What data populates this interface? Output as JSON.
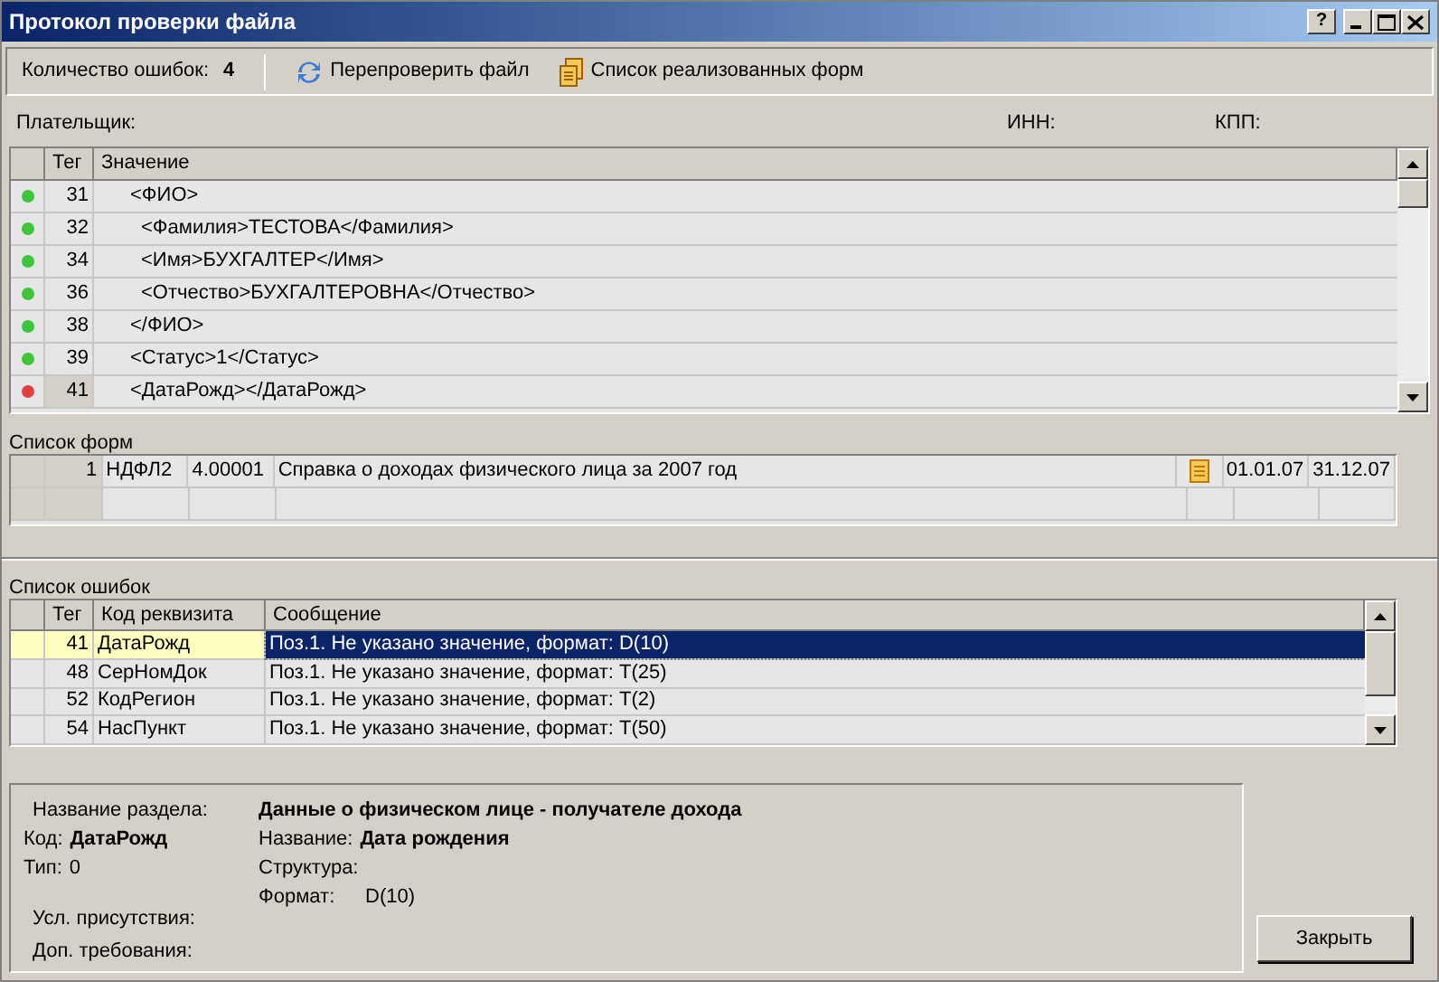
{
  "window": {
    "title": "Протокол проверки файла",
    "buttons": [
      "?"
    ]
  },
  "toolbar": {
    "error_count_label": "Количество ошибок:",
    "error_count": "4",
    "recheck": "Перепроверить файл",
    "forms_list": "Список реализованных форм"
  },
  "payer": {
    "payer_label": "Плательщик:",
    "inn_label": "ИНН:",
    "kpp_label": "КПП:"
  },
  "tree": {
    "columns": [
      "Тег",
      "Значение"
    ],
    "rows": [
      {
        "error": false,
        "tag": "31",
        "value": "<ФИО>",
        "indent": false,
        "selected": false
      },
      {
        "error": false,
        "tag": "32",
        "value": "<Фамилия>ТЕСТОВА</Фамилия>",
        "indent": true,
        "selected": false
      },
      {
        "error": false,
        "tag": "34",
        "value": "<Имя>БУХГАЛТЕР</Имя>",
        "indent": true,
        "selected": false
      },
      {
        "error": false,
        "tag": "36",
        "value": "<Отчество>БУХГАЛТЕРОВНА</Отчество>",
        "indent": true,
        "selected": false
      },
      {
        "error": false,
        "tag": "38",
        "value": "</ФИО>",
        "indent": false,
        "selected": false
      },
      {
        "error": false,
        "tag": "39",
        "value": "<Статус>1</Статус>",
        "indent": false,
        "selected": false
      },
      {
        "error": true,
        "tag": "41",
        "value": "<ДатаРожд></ДатаРожд>",
        "indent": false,
        "selected": true
      }
    ]
  },
  "forms": {
    "title": "Список форм",
    "rows": [
      {
        "num": "1",
        "code": "НДФЛ2",
        "version": "4.00001",
        "name": "Справка о доходах физического лица за 2007 год",
        "from": "01.01.07",
        "to": "31.12.07"
      }
    ]
  },
  "errors": {
    "title": "Список ошибок",
    "columns": [
      "Тег",
      "Код реквизита",
      "Сообщение"
    ],
    "rows": [
      {
        "tag": "41",
        "code": "ДатаРожд",
        "message": "Поз.1. Не указано значение, формат: D(10)",
        "selected": true
      },
      {
        "tag": "48",
        "code": "СерНомДок",
        "message": "Поз.1. Не указано значение, формат: T(25)",
        "selected": false
      },
      {
        "tag": "52",
        "code": "КодРегион",
        "message": "Поз.1. Не указано значение, формат: T(2)",
        "selected": false
      },
      {
        "tag": "54",
        "code": "НасПункт",
        "message": "Поз.1. Не указано значение, формат: T(50)",
        "selected": false
      }
    ]
  },
  "details": {
    "section_label": "Название раздела:",
    "section_value": "Данные о физическом лице - получателе дохода",
    "code_label": "Код:",
    "code_value": "ДатаРожд",
    "name_label": "Название:",
    "name_value": "Дата рождения",
    "type_label": "Тип:",
    "type_value": "0",
    "structure_label": "Структура:",
    "format_label": "Формат:",
    "format_value": "D(10)",
    "presence_label": "Усл. присутствия:",
    "requirements_label": "Доп. требования:"
  },
  "close_button": "Закрыть"
}
